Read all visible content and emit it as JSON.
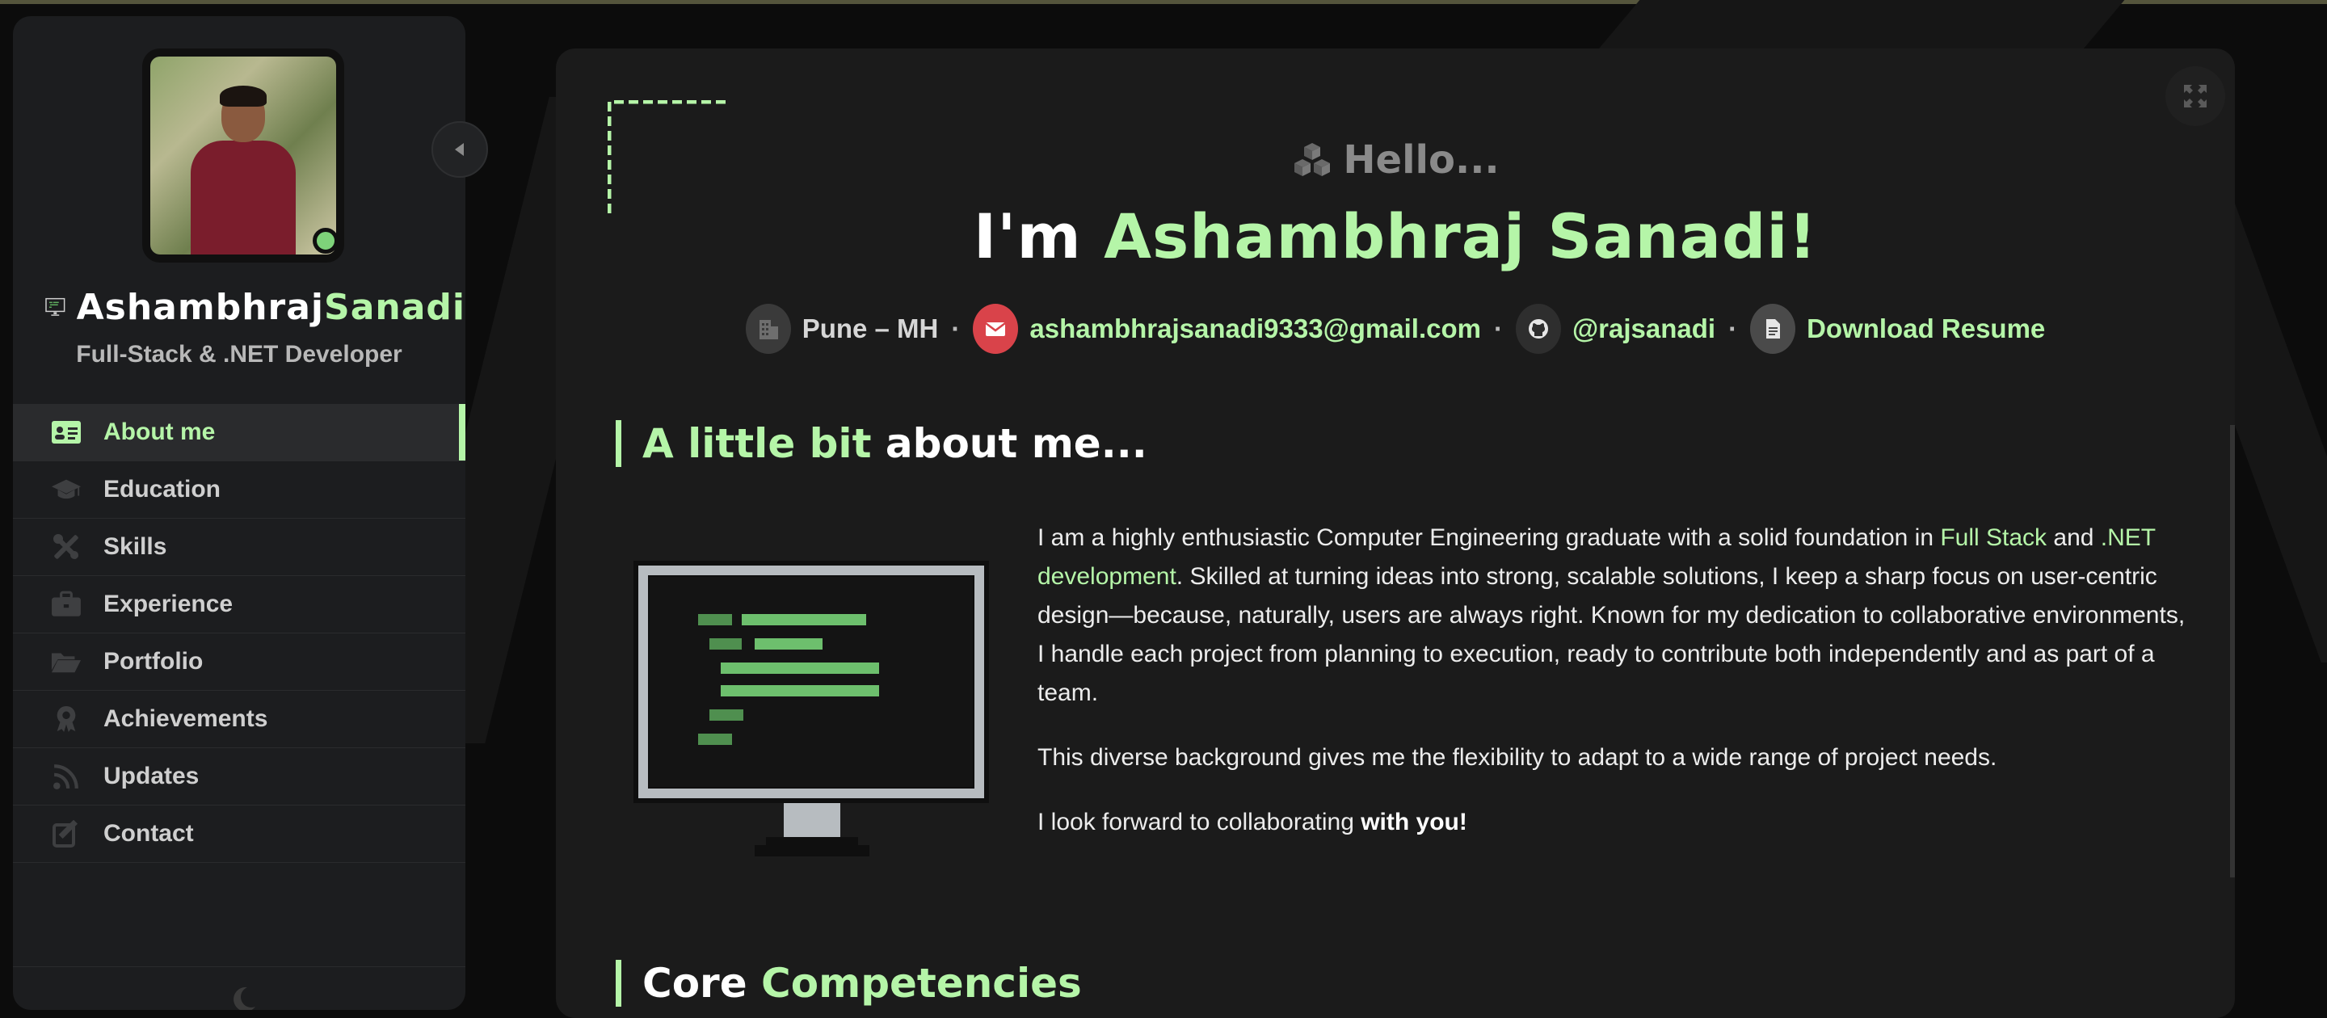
{
  "sidebar": {
    "brand_first": "Ashambhraj",
    "brand_last": "Sanadi",
    "role": "Full-Stack & .NET Developer",
    "nav": [
      {
        "label": "About me",
        "icon": "id-card-icon",
        "active": true
      },
      {
        "label": "Education",
        "icon": "graduation-cap-icon",
        "active": false
      },
      {
        "label": "Skills",
        "icon": "tools-icon",
        "active": false
      },
      {
        "label": "Experience",
        "icon": "briefcase-icon",
        "active": false
      },
      {
        "label": "Portfolio",
        "icon": "folder-open-icon",
        "active": false
      },
      {
        "label": "Achievements",
        "icon": "award-icon",
        "active": false
      },
      {
        "label": "Updates",
        "icon": "rss-icon",
        "active": false
      },
      {
        "label": "Contact",
        "icon": "edit-icon",
        "active": false
      }
    ],
    "status": "online",
    "theme_toggle_icon": "moon-icon"
  },
  "hero": {
    "greeting": "Hello...",
    "greeting_icon": "cubes-icon",
    "headline_prefix": "I'm",
    "headline_name": "Ashambhraj Sanadi!",
    "location": "Pune – MH",
    "email": "ashambhrajsanadi9333@gmail.com",
    "github": "@rajsanadi",
    "resume": "Download Resume",
    "separator": "·"
  },
  "about": {
    "title_green": "A little bit",
    "title_white": "about me...",
    "p1_before": "I am a highly enthusiastic Computer Engineering graduate with a solid foundation in ",
    "p1_hl1": "Full Stack",
    "p1_mid": " and ",
    "p1_hl2": ".NET development",
    "p1_after": ". Skilled at turning ideas into strong, scalable solutions, I keep a sharp focus on user-centric design—because, naturally, users are always right. Known for my dedication to collaborative environments, I handle each project from planning to execution, ready to contribute both independently and as part of a team.",
    "p2": "This diverse background gives me the flexibility to adapt to a wide range of project needs.",
    "p3_before": "I look forward to collaborating ",
    "p3_bold": "with you!"
  },
  "competencies": {
    "title_white": "Core",
    "title_green": "Competencies"
  },
  "colors": {
    "accent": "#b5f5a8",
    "background": "#0c0c0c",
    "panel": "#1b1b1b",
    "sidebar": "#1c1d1f",
    "email_icon_bg": "#d9434a",
    "neutral_icon_bg": "#3a3a3a"
  }
}
